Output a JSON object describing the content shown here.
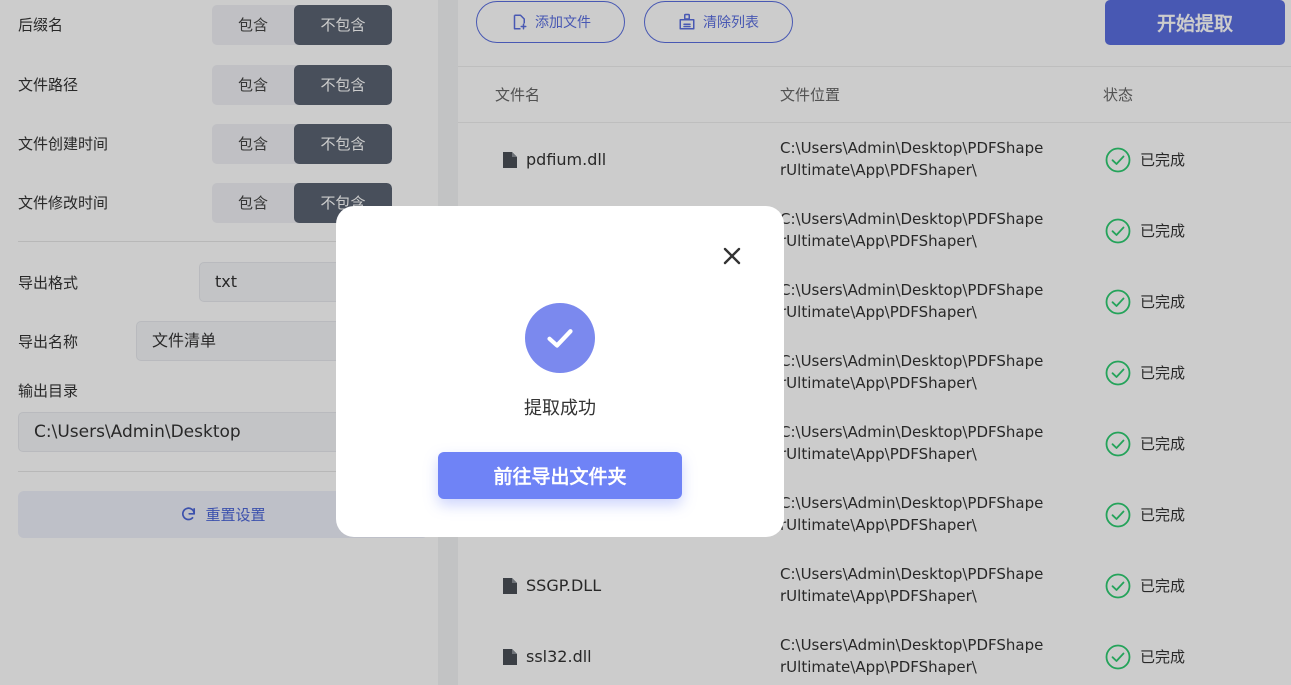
{
  "left_panel": {
    "options": [
      {
        "label": "后缀名",
        "include": "包含",
        "exclude": "不包含",
        "selected": "exclude"
      },
      {
        "label": "文件路径",
        "include": "包含",
        "exclude": "不包含",
        "selected": "exclude"
      },
      {
        "label": "文件创建时间",
        "include": "包含",
        "exclude": "不包含",
        "selected": "exclude"
      },
      {
        "label": "文件修改时间",
        "include": "包含",
        "exclude": "不包含",
        "selected": "exclude"
      }
    ],
    "export_format": {
      "label": "导出格式",
      "value": "txt"
    },
    "export_name": {
      "label": "导出名称",
      "value": "文件清单"
    },
    "output_dir": {
      "label": "输出目录",
      "value": "C:\\Users\\Admin\\Desktop"
    },
    "reset_button": {
      "label": "重置设置",
      "icon": "refresh-icon"
    }
  },
  "toolbar": {
    "add_file": {
      "label": "添加文件",
      "icon": "add-file-icon"
    },
    "clear_list": {
      "label": "清除列表",
      "icon": "clear-list-icon"
    },
    "start": {
      "label": "开始提取"
    }
  },
  "table": {
    "headers": {
      "name": "文件名",
      "location": "文件位置",
      "status": "状态"
    },
    "rows": [
      {
        "name": "pdfium.dll",
        "location_line1": "C:\\Users\\Admin\\Desktop\\PDFShape",
        "location_line2": "rUltimate\\App\\PDFShaper\\",
        "status": "已完成"
      },
      {
        "name": "",
        "location_line1": "C:\\Users\\Admin\\Desktop\\PDFShape",
        "location_line2": "rUltimate\\App\\PDFShaper\\",
        "status": "已完成"
      },
      {
        "name": "",
        "location_line1": "C:\\Users\\Admin\\Desktop\\PDFShape",
        "location_line2": "rUltimate\\App\\PDFShaper\\",
        "status": "已完成"
      },
      {
        "name": "",
        "location_line1": "C:\\Users\\Admin\\Desktop\\PDFShape",
        "location_line2": "rUltimate\\App\\PDFShaper\\",
        "status": "已完成"
      },
      {
        "name": "",
        "location_line1": "C:\\Users\\Admin\\Desktop\\PDFShape",
        "location_line2": "rUltimate\\App\\PDFShaper\\",
        "status": "已完成"
      },
      {
        "name": "",
        "location_line1": "C:\\Users\\Admin\\Desktop\\PDFShape",
        "location_line2": "rUltimate\\App\\PDFShaper\\",
        "status": "已完成"
      },
      {
        "name": "SSGP.DLL",
        "location_line1": "C:\\Users\\Admin\\Desktop\\PDFShape",
        "location_line2": "rUltimate\\App\\PDFShaper\\",
        "status": "已完成"
      },
      {
        "name": "ssl32.dll",
        "location_line1": "C:\\Users\\Admin\\Desktop\\PDFShape",
        "location_line2": "rUltimate\\App\\PDFShaper\\",
        "status": "已完成"
      }
    ]
  },
  "modal": {
    "message": "提取成功",
    "button": "前往导出文件夹",
    "icon": "success-check-icon"
  },
  "colors": {
    "accent": "#5b6fe0",
    "success": "#2ecc71",
    "segment_selected": "#5a6372"
  }
}
